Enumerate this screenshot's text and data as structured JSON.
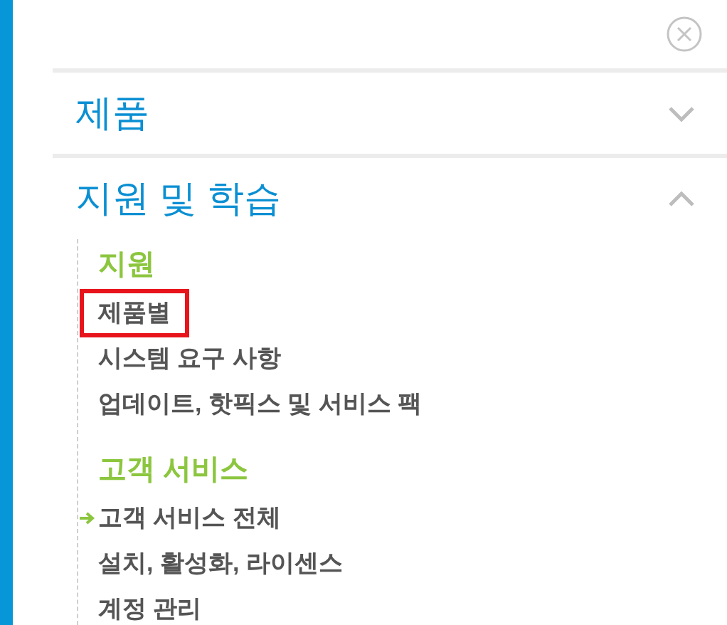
{
  "sections": [
    {
      "title": "제품",
      "expanded": false
    },
    {
      "title": "지원 및 학습",
      "expanded": true,
      "groups": [
        {
          "heading": "지원",
          "items": [
            {
              "label": "제품별",
              "highlighted": true,
              "current": false
            },
            {
              "label": "시스템 요구 사항",
              "highlighted": false,
              "current": false
            },
            {
              "label": "업데이트, 핫픽스 및 서비스 팩",
              "highlighted": false,
              "current": false
            }
          ]
        },
        {
          "heading": "고객 서비스",
          "items": [
            {
              "label": "고객 서비스 전체",
              "highlighted": false,
              "current": true
            },
            {
              "label": "설치, 활성화, 라이센스",
              "highlighted": false,
              "current": false
            },
            {
              "label": "계정 관리",
              "highlighted": false,
              "current": false
            }
          ]
        }
      ]
    }
  ]
}
